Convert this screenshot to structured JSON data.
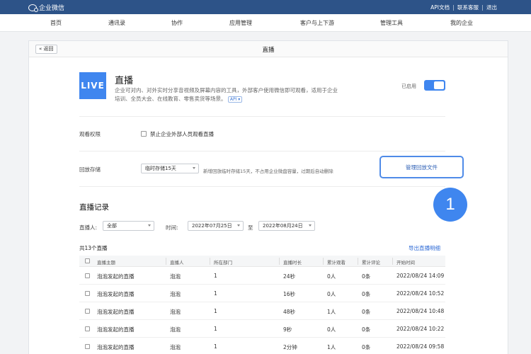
{
  "topbar": {
    "brand": "企业微信",
    "links": [
      "API文档",
      "联系客服",
      "退出"
    ]
  },
  "nav": {
    "items": [
      "首页",
      "通讯录",
      "协作",
      "应用管理",
      "客户与上下游",
      "管理工具",
      "我的企业"
    ]
  },
  "page": {
    "back_label": "« 返回",
    "title": "直播"
  },
  "app": {
    "logo_text": "LIVE",
    "name": "直播",
    "description": "企业可对内、对外实时分享音视频及屏幕内容的工具，外部客户使用微信即可观看，适用于企业培训、全员大会、在线教育、零售卖货等场景。",
    "api_tag": "API ▾",
    "status_label": "已启用",
    "enabled": true
  },
  "permissions": {
    "label": "观看权限",
    "checkbox_label": "禁止企业外部人员观看直播",
    "checked": false
  },
  "replay": {
    "label": "回放存储",
    "selected": "临时存储15天",
    "note": "新增回放临时存储15天，不占用企业微盘容量，过期后自动删除",
    "manage_label": "管理回放文件"
  },
  "callout": {
    "number": "1"
  },
  "records": {
    "title": "直播记录",
    "host_filter_label": "直播人:",
    "host_filter_value": "全部",
    "time_label": "时间:",
    "date_from": "2022年07月25日",
    "to_label": "至",
    "date_to": "2022年08月24日",
    "total": "共13个直播",
    "export_label": "导出直播明细",
    "columns": [
      "直播主题",
      "直播人",
      "所在部门",
      "直播时长",
      "累计观看",
      "累计评论",
      "开始时间"
    ],
    "rows": [
      [
        "泡泡发起的直播",
        "泡泡",
        "1",
        "24秒",
        "0人",
        "0条",
        "2022/08/24 14:09"
      ],
      [
        "泡泡发起的直播",
        "泡泡",
        "1",
        "16秒",
        "0人",
        "0条",
        "2022/08/24 10:52"
      ],
      [
        "泡泡发起的直播",
        "泡泡",
        "1",
        "48秒",
        "1人",
        "0条",
        "2022/08/24 10:48"
      ],
      [
        "泡泡发起的直播",
        "泡泡",
        "1",
        "9秒",
        "0人",
        "0条",
        "2022/08/24 10:22"
      ],
      [
        "泡泡发起的直播",
        "泡泡",
        "1",
        "2分钟",
        "1人",
        "0条",
        "2022/08/24 09:58"
      ]
    ]
  },
  "colors": {
    "topbar": "#2d5388",
    "accent": "#3f86ef",
    "link": "#2d6ad6"
  }
}
